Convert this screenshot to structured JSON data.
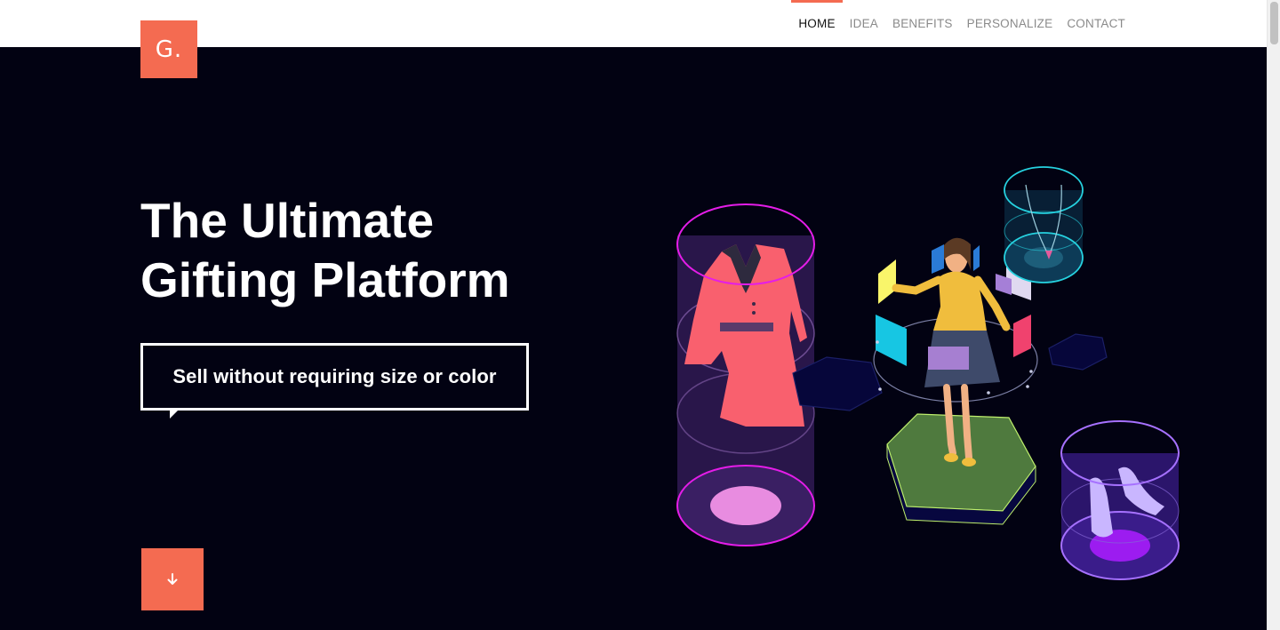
{
  "logo": {
    "text": "G."
  },
  "nav": {
    "items": [
      {
        "label": "HOME",
        "active": true
      },
      {
        "label": "IDEA"
      },
      {
        "label": "BENEFITS"
      },
      {
        "label": "PERSONALIZE"
      },
      {
        "label": "CONTACT"
      }
    ]
  },
  "hero": {
    "title": "The Ultimate\nGifting Platform",
    "tagline": "Sell without requiring size or color",
    "down_icon": "arrow-down-icon"
  },
  "colors": {
    "accent": "#f46b51",
    "hero_bg": "#020212",
    "nav_text": "#8a8a8a",
    "nav_active": "#111111"
  }
}
